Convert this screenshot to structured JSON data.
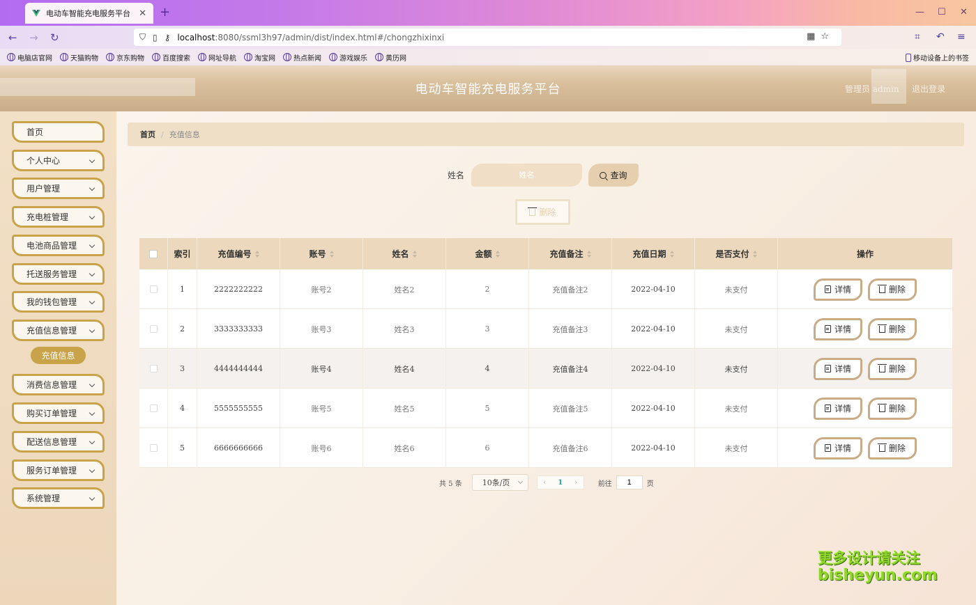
{
  "browser": {
    "tab_title": "电动车智能充电服务平台",
    "url_host": "localhost",
    "url_path": ":8080/ssml3h97/admin/dist/index.html#/chongzhixinxi",
    "bookmarks": [
      "电脑店官网",
      "天猫购物",
      "京东购物",
      "百度搜索",
      "网址导航",
      "淘宝网",
      "热点新闻",
      "游戏娱乐",
      "黄历网"
    ],
    "mobile_bookmarks": "移动设备上的书签"
  },
  "header": {
    "title": "电动车智能充电服务平台",
    "user_label": "管理员 admin",
    "logout_label": "退出登录"
  },
  "sidebar": {
    "items": [
      "首页",
      "个人中心",
      "用户管理",
      "充电桩管理",
      "电池商品管理",
      "托送服务管理",
      "我的钱包管理",
      "充值信息管理",
      "消费信息管理",
      "购买订单管理",
      "配送信息管理",
      "服务订单管理",
      "系统管理"
    ],
    "active_sub": "充值信息"
  },
  "breadcrumb": {
    "home": "首页",
    "sep": "/",
    "current": "充值信息"
  },
  "search": {
    "label": "姓名",
    "placeholder": "姓名",
    "query_label": "查询",
    "batch_delete_label": "删除"
  },
  "table": {
    "headers": [
      "索引",
      "充值编号",
      "账号",
      "姓名",
      "金额",
      "充值备注",
      "充值日期",
      "是否支付",
      "操作"
    ],
    "rows": [
      {
        "index": "1",
        "code": "2222222222",
        "account": "账号2",
        "name": "姓名2",
        "amount": "2",
        "remark": "充值备注2",
        "date": "2022-04-10",
        "paid": "未支付"
      },
      {
        "index": "2",
        "code": "3333333333",
        "account": "账号3",
        "name": "姓名3",
        "amount": "3",
        "remark": "充值备注3",
        "date": "2022-04-10",
        "paid": "未支付"
      },
      {
        "index": "3",
        "code": "4444444444",
        "account": "账号4",
        "name": "姓名4",
        "amount": "4",
        "remark": "充值备注4",
        "date": "2022-04-10",
        "paid": "未支付"
      },
      {
        "index": "4",
        "code": "5555555555",
        "account": "账号5",
        "name": "姓名5",
        "amount": "5",
        "remark": "充值备注5",
        "date": "2022-04-10",
        "paid": "未支付"
      },
      {
        "index": "5",
        "code": "6666666666",
        "account": "账号6",
        "name": "姓名6",
        "amount": "6",
        "remark": "充值备注6",
        "date": "2022-04-10",
        "paid": "未支付"
      }
    ],
    "detail_label": "详情",
    "delete_label": "删除"
  },
  "pager": {
    "total": "共 5 条",
    "page_size": "10条/页",
    "current_page": "1",
    "goto_label": "前往",
    "goto_value": "1",
    "page_suffix": "页"
  },
  "watermark": {
    "line1": "更多设计请关注",
    "line2": "bisheyun.com"
  },
  "colors": {
    "accent": "#c9a34a",
    "header_bg": "#d9bf9c",
    "table_head": "#ecd9bd"
  }
}
